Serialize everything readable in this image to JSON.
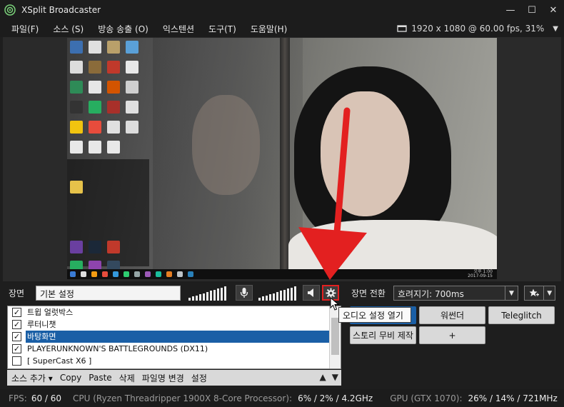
{
  "window": {
    "title": "XSplit Broadcaster",
    "controls": {
      "minimize": "—",
      "maximize": "☐",
      "close": "✕"
    }
  },
  "menu": {
    "items": [
      "파일(F)",
      "소스 (S)",
      "방송 송출 (O)",
      "익스텐션",
      "도구(T)",
      "도움말(H)"
    ],
    "resolution": "1920 x 1080 @ 60.00 fps, 31%",
    "resolution_arrow": "▼"
  },
  "preview": {
    "clock_time": "오후 1:00",
    "clock_date": "2017-09-15"
  },
  "scene": {
    "label": "장면",
    "name_value": "기본 설정",
    "transition_label": "장면 전환",
    "transition_value": "흐려지기: 700ms",
    "dropdown_arrow": "▼"
  },
  "sources": {
    "items": [
      {
        "label": "트윕 얼럿박스",
        "checked": true,
        "selected": false
      },
      {
        "label": "루터니챗",
        "checked": true,
        "selected": false
      },
      {
        "label": "바탕화면",
        "checked": true,
        "selected": true
      },
      {
        "label": "PLAYERUNKNOWN'S BATTLEGROUNDS (DX11)",
        "checked": true,
        "selected": false
      },
      {
        "label": "[ SuperCast X6 ]",
        "checked": false,
        "selected": false
      }
    ],
    "toolbar": {
      "add": "소스 추가 ▾",
      "copy": "Copy",
      "paste": "Paste",
      "delete": "삭제",
      "rename": "파일명 변경",
      "settings": "설정",
      "up": "▲",
      "down": "▼"
    }
  },
  "tooltip": "오디오 설정 열기",
  "scene_buttons": {
    "b1": "워썬더",
    "b2": "Teleglitch",
    "b3": "스토리 무비 제작",
    "b4": "+"
  },
  "status": {
    "fps_label": "FPS:",
    "fps_value": "60 / 60",
    "cpu_label": "CPU (Ryzen Threadripper 1900X 8-Core Processor):",
    "cpu_value": "6% / 2% / 4.2GHz",
    "gpu_label": "GPU (GTX 1070):",
    "gpu_value": "26% / 14% / 721MHz"
  },
  "colors": {
    "accent_red": "#e32020",
    "selection_blue": "#1a5fa6",
    "chrome_dark": "#1c1c1c"
  }
}
